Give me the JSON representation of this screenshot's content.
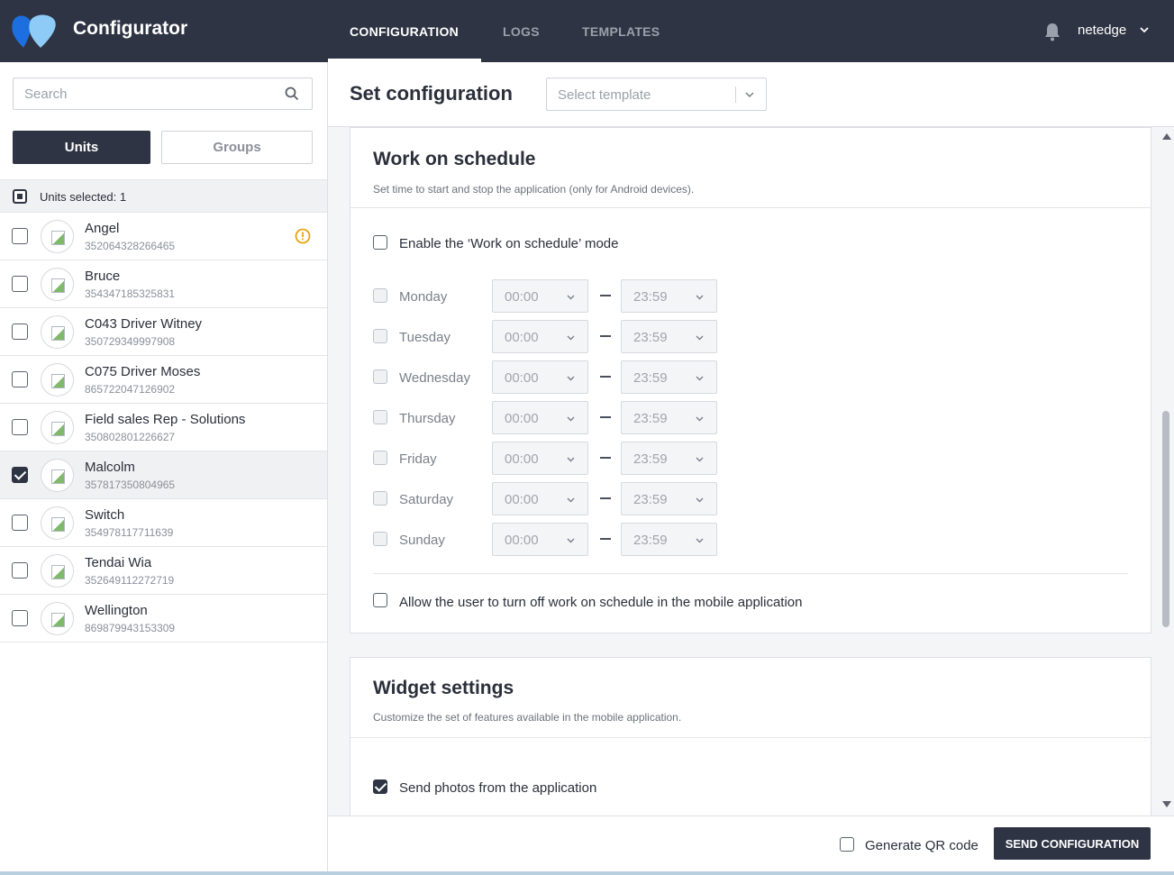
{
  "app": {
    "brand": "Configurator"
  },
  "nav": {
    "tabs": [
      "CONFIGURATION",
      "LOGS",
      "TEMPLATES"
    ],
    "active": "CONFIGURATION"
  },
  "user": {
    "name": "netedge"
  },
  "sidebar": {
    "search_placeholder": "Search",
    "units_label": "Units",
    "groups_label": "Groups",
    "selected_text": "Units selected: 1",
    "units": [
      {
        "name": "Angel",
        "id": "352064328266465",
        "checked": false,
        "warning": true
      },
      {
        "name": "Bruce",
        "id": "354347185325831",
        "checked": false,
        "warning": false
      },
      {
        "name": "C043 Driver Witney",
        "id": "350729349997908",
        "checked": false,
        "warning": false
      },
      {
        "name": "C075 Driver Moses",
        "id": "865722047126902",
        "checked": false,
        "warning": false
      },
      {
        "name": "Field sales Rep - Solutions",
        "id": "350802801226627",
        "checked": false,
        "warning": false
      },
      {
        "name": "Malcolm",
        "id": "357817350804965",
        "checked": true,
        "warning": false
      },
      {
        "name": "Switch",
        "id": "354978117711639",
        "checked": false,
        "warning": false
      },
      {
        "name": "Tendai Wia",
        "id": "352649112272719",
        "checked": false,
        "warning": false
      },
      {
        "name": "Wellington",
        "id": "869879943153309",
        "checked": false,
        "warning": false
      }
    ]
  },
  "main": {
    "title": "Set configuration",
    "template_placeholder": "Select template",
    "schedule": {
      "title": "Work on schedule",
      "subtitle": "Set time to start and stop the application (only for Android devices).",
      "enable_label": "Enable the ‘Work on schedule’ mode",
      "days": [
        {
          "name": "Monday",
          "from": "00:00",
          "to": "23:59"
        },
        {
          "name": "Tuesday",
          "from": "00:00",
          "to": "23:59"
        },
        {
          "name": "Wednesday",
          "from": "00:00",
          "to": "23:59"
        },
        {
          "name": "Thursday",
          "from": "00:00",
          "to": "23:59"
        },
        {
          "name": "Friday",
          "from": "00:00",
          "to": "23:59"
        },
        {
          "name": "Saturday",
          "from": "00:00",
          "to": "23:59"
        },
        {
          "name": "Sunday",
          "from": "00:00",
          "to": "23:59"
        }
      ],
      "allow_label": "Allow the user to turn off work on schedule in the mobile application"
    },
    "widget": {
      "title": "Widget settings",
      "subtitle": "Customize the set of features available in the mobile application.",
      "send_photos_label": "Send photos from the application"
    }
  },
  "footer": {
    "qr_label": "Generate QR code",
    "send_label": "SEND CONFIGURATION"
  },
  "colors": {
    "dark": "#2e3443",
    "warning": "#e8a317",
    "logo_blue": "#1d6fe0",
    "logo_light": "#8ecbf6"
  }
}
